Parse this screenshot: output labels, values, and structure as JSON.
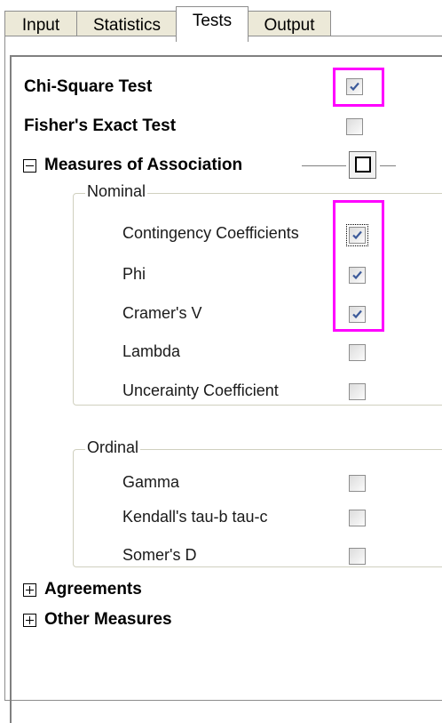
{
  "tabs": [
    {
      "label": "Input"
    },
    {
      "label": "Statistics"
    },
    {
      "label": "Tests"
    },
    {
      "label": "Output"
    }
  ],
  "active_tab": "Tests",
  "chi_square": {
    "label": "Chi-Square Test",
    "checked": true
  },
  "fisher": {
    "label": "Fisher's Exact Test",
    "checked": false
  },
  "measures": {
    "label": "Measures of Association",
    "expanded": true,
    "nominal": {
      "title": "Nominal",
      "items": [
        {
          "label": "Contingency Coefficients",
          "checked": true
        },
        {
          "label": "Phi",
          "checked": true
        },
        {
          "label": "Cramer's V",
          "checked": true
        },
        {
          "label": "Lambda",
          "checked": false
        },
        {
          "label": "Uncerainty Coefficient",
          "checked": false
        }
      ]
    },
    "ordinal": {
      "title": "Ordinal",
      "items": [
        {
          "label": "Gamma",
          "checked": false
        },
        {
          "label": "Kendall's tau-b  tau-c",
          "checked": false
        },
        {
          "label": "Somer's D",
          "checked": false
        }
      ]
    }
  },
  "agreements": {
    "label": "Agreements",
    "expanded": false
  },
  "other_measures": {
    "label": "Other Measures",
    "expanded": false
  },
  "colors": {
    "highlight": "#ff00ff",
    "check": "#3c5a9a"
  }
}
